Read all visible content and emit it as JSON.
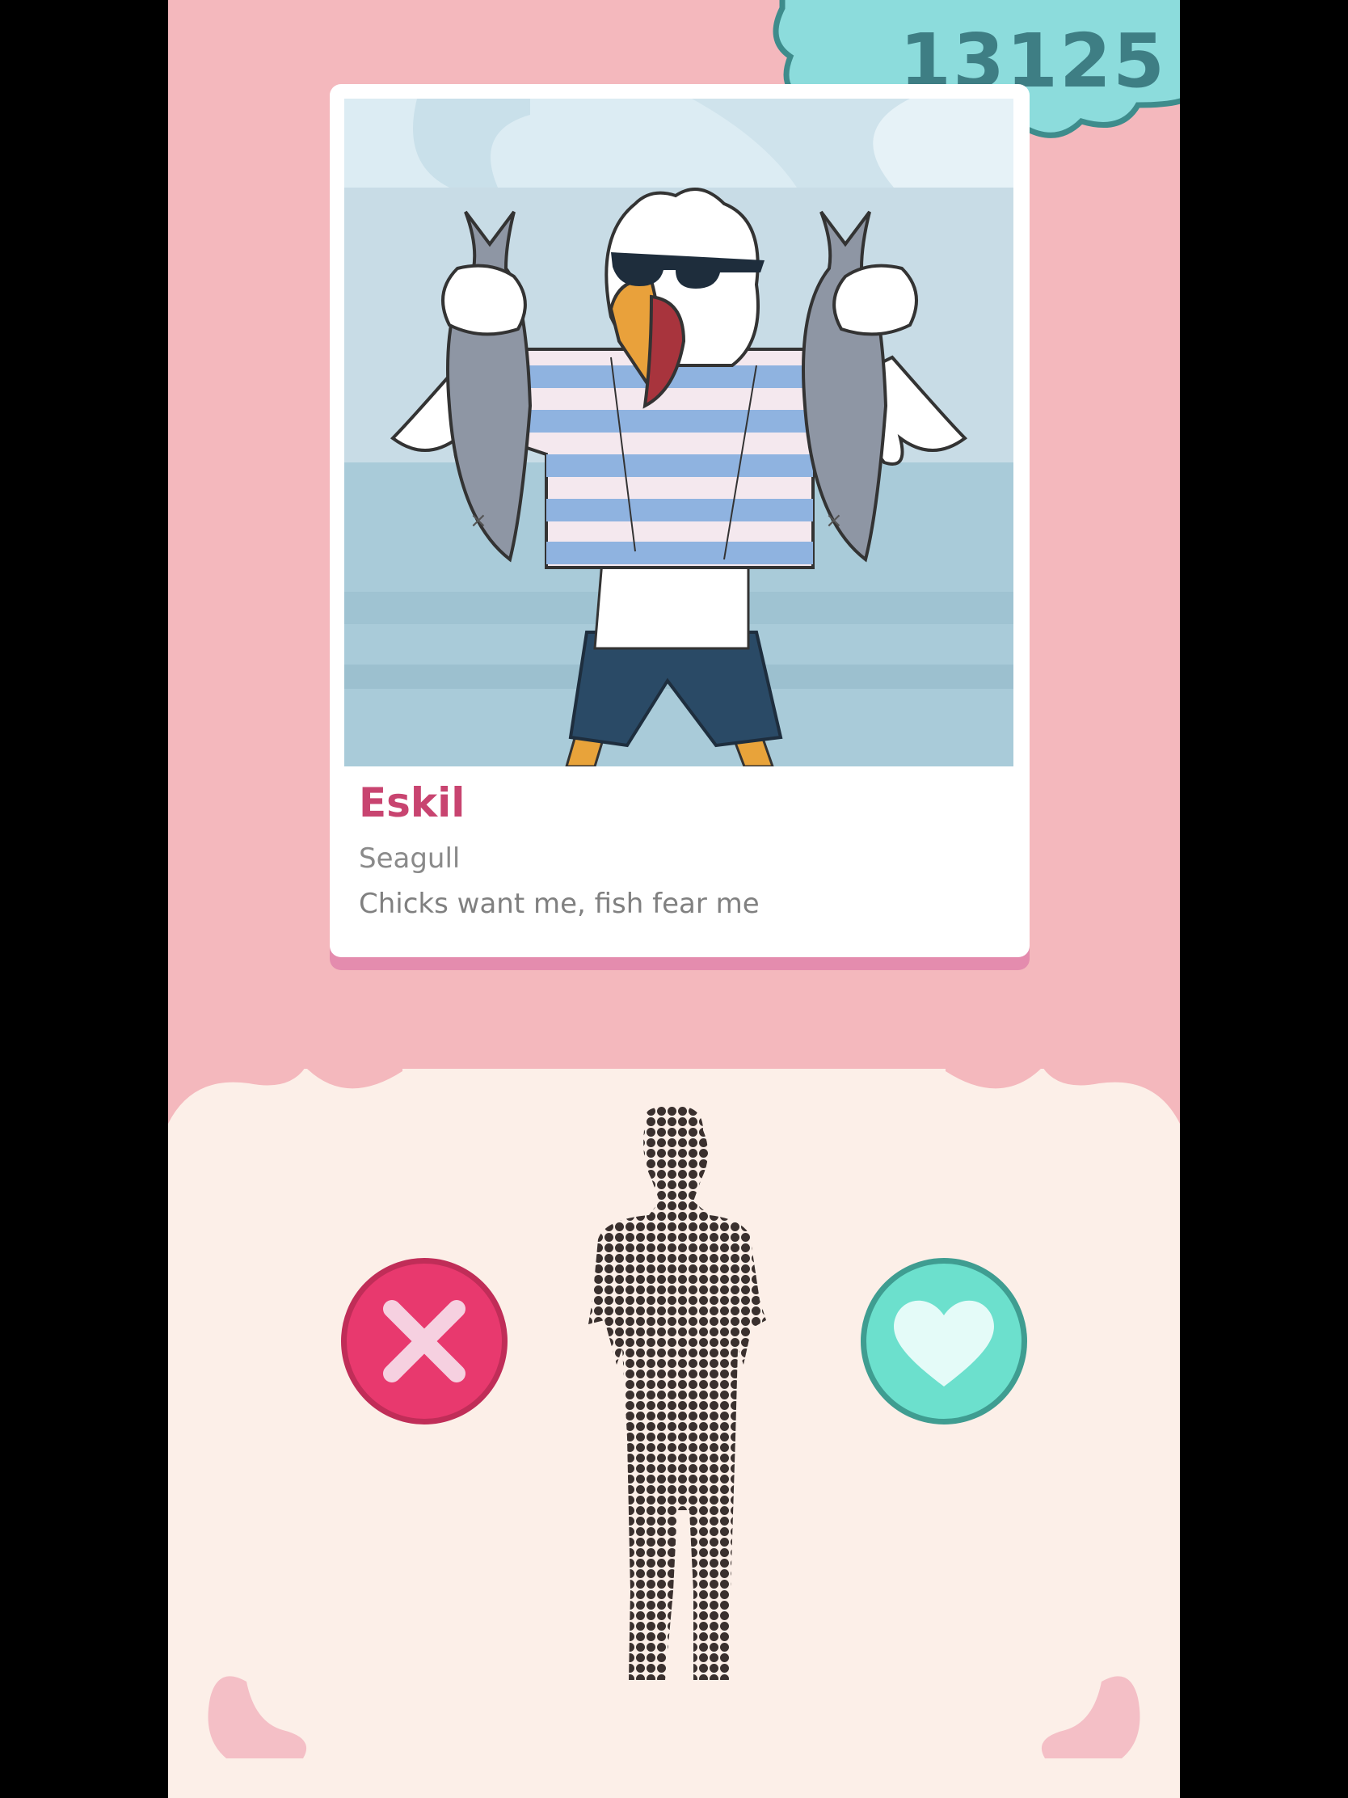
{
  "score": {
    "value": "13125"
  },
  "profile": {
    "name": "Eskil",
    "species": "Seagull",
    "bio": "Chicks want me, fish fear me",
    "photo_icon": "seagull-with-fish-illustration"
  },
  "actions": {
    "dislike_icon": "x-icon",
    "like_icon": "heart-icon"
  },
  "colors": {
    "top_band": "#f4b8bd",
    "bottom_band": "#fcefe8",
    "score_cloud": "#8cdcdc",
    "score_text": "#3e7e84",
    "name": "#c84470",
    "dislike": "#e8396e",
    "like": "#6ce0cd"
  }
}
